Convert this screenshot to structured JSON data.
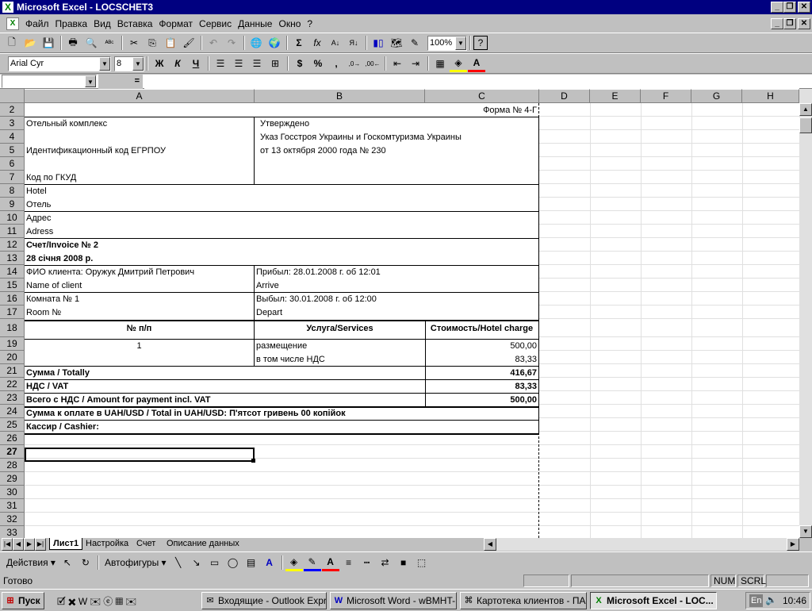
{
  "window": {
    "title": "Microsoft Excel - LOCSCHET3"
  },
  "menu": [
    "Файл",
    "Правка",
    "Вид",
    "Вставка",
    "Формат",
    "Сервис",
    "Данные",
    "Окно",
    "?"
  ],
  "toolbar": {
    "zoom": "100%",
    "font": "Arial Cyr",
    "font_size": "8",
    "bold_label": "Ж",
    "italic_label": "К",
    "underline_label": "Ч"
  },
  "formula": {
    "name_box": "",
    "equals": "="
  },
  "columns": [
    "A",
    "B",
    "C",
    "D",
    "E",
    "F",
    "G",
    "H"
  ],
  "rows": [
    "2",
    "3",
    "4",
    "5",
    "6",
    "7",
    "8",
    "9",
    "10",
    "11",
    "12",
    "13",
    "14",
    "15",
    "16",
    "17",
    "18",
    "19",
    "20",
    "21",
    "22",
    "23",
    "24",
    "25",
    "26",
    "27",
    "28",
    "29",
    "30",
    "31",
    "32",
    "33"
  ],
  "cells": {
    "form_no": "Форма № 4-Г",
    "hotel_complex": "Отельный комплекс",
    "approved": "Утверждено",
    "decree": "Указ Госстроя Украины и Госкомтуризма Украины",
    "edrpou": "Идентификационный код ЕГРПОУ",
    "decree_date": "от 13 октября 2000 года № 230",
    "gkud": "Код по ГКУД",
    "hotel_en": "Hotel",
    "hotel_ru": "Отель",
    "address_ru": "Адрес",
    "address_en": "Adress",
    "invoice": "Счет/Invoice № 2",
    "invoice_date": "28 січня 2008 р.",
    "client_name": "ФИО клиента: Оружук Дмитрий Петрович",
    "arrival": "Прибыл: 28.01.2008 г. об 12:01",
    "name_of_client": "Name of client",
    "arrive": "Arrive",
    "room": "Комната № 1",
    "departure": "Выбыл: 30.01.2008 г. об 12:00",
    "room_en": "Room №",
    "depart": "Depart",
    "hdr_no": "№ п/п",
    "hdr_services": "Услуга/Services",
    "hdr_charge": "Стоимость/Hotel charge",
    "item_no": "1",
    "item_name": "размещение",
    "item_price": "500,00",
    "vat_included": "в том числе НДС",
    "vat_included_value": "83,33",
    "total_label": "Сумма / Totally",
    "total_value": "416,67",
    "vat_label": "НДС / VAT",
    "vat_value": "83,33",
    "grand_label": "Всего с НДС / Amount for payment incl. VAT",
    "grand_value": "500,00",
    "amount_words": "Сумма к оплате в UAH/USD / Total in UAH/USD: П'ятсот гривень 00 копійок",
    "cashier": "Кассир / Cashier:"
  },
  "sheets": [
    "Лист1",
    "Настройка",
    "Счет",
    "Описание данных"
  ],
  "drawing": {
    "actions": "Действия",
    "autoshapes": "Автофигуры"
  },
  "status": {
    "ready": "Готово",
    "num": "NUM",
    "scrl": "SCRL"
  },
  "taskbar": {
    "start": "Пуск",
    "tasks": [
      "Входящие - Outlook Expre...",
      "Microsoft Word - wBMHT-...",
      "Картотека клиентов - ПА...",
      "Microsoft Excel - LOC..."
    ],
    "lang": "En",
    "clock": "10:46"
  }
}
